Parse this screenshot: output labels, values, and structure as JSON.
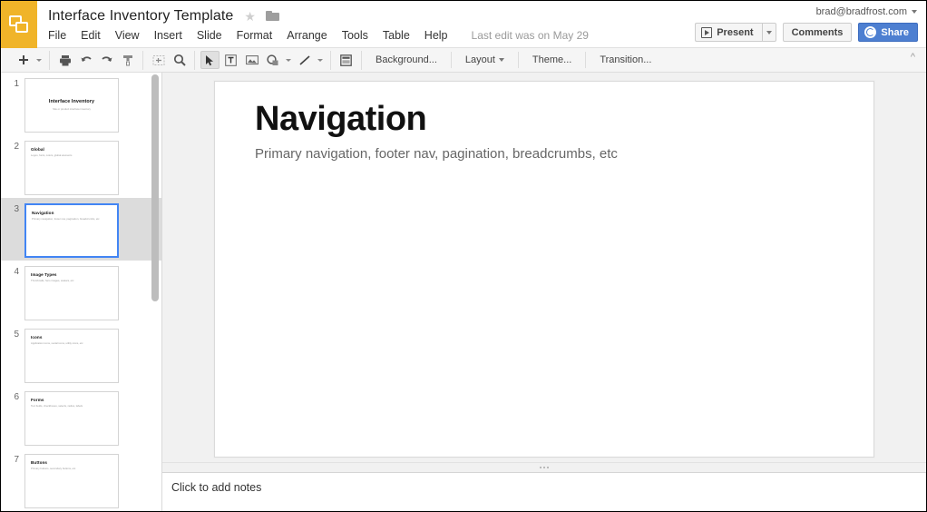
{
  "header": {
    "logo_icon": "slides-logo-icon",
    "doc_title": "Interface Inventory Template",
    "star_icon": "★",
    "folder_icon": "folder-icon",
    "menus": [
      "File",
      "Edit",
      "View",
      "Insert",
      "Slide",
      "Format",
      "Arrange",
      "Tools",
      "Table",
      "Help"
    ],
    "last_edit": "Last edit was on May 29",
    "account_email": "brad@bradfrost.com",
    "present_label": "Present",
    "comments_label": "Comments",
    "share_label": "Share",
    "share_color": "#4d7fd1",
    "logo_color": "#f0b429"
  },
  "toolbar": {
    "new_slide_icon": "plus-icon",
    "print_icon": "print-icon",
    "undo_icon": "undo-icon",
    "redo_icon": "redo-icon",
    "paint_format_icon": "paint-format-icon",
    "fit_icon": "fit-to-screen-icon",
    "zoom_icon": "magnifier-icon",
    "select_icon": "select-arrow-icon",
    "textbox_icon": "text-box-icon",
    "image_icon": "image-icon",
    "shape_icon": "shape-icon",
    "line_icon": "line-icon",
    "layout_icon": "layout-icon",
    "background_label": "Background...",
    "layout_label": "Layout",
    "theme_label": "Theme...",
    "transition_label": "Transition...",
    "collapse_icon": "chevron-up-icon"
  },
  "filmstrip": {
    "slides": [
      {
        "num": "1",
        "title": "Interface Inventory",
        "sub": "Site or product interface inventory",
        "centered": true,
        "selected": false
      },
      {
        "num": "2",
        "title": "Global",
        "sub": "Logos, fonts, colors, global elements",
        "centered": false,
        "selected": false
      },
      {
        "num": "3",
        "title": "Navigation",
        "sub": "Primary navigation, footer nav, pagination, breadcrumbs, etc",
        "centered": false,
        "selected": true
      },
      {
        "num": "4",
        "title": "Image Types",
        "sub": "Thumbnails, hero images, avatars, etc",
        "centered": false,
        "selected": false
      },
      {
        "num": "5",
        "title": "Icons",
        "sub": "Application icons, social icons, utility icons, etc",
        "centered": false,
        "selected": false
      },
      {
        "num": "6",
        "title": "Forms",
        "sub": "Text fields, checkboxes, selects, radios, labels",
        "centered": false,
        "selected": false
      },
      {
        "num": "7",
        "title": "Buttons",
        "sub": "Primary buttons, secondary buttons, etc",
        "centered": false,
        "selected": false
      }
    ]
  },
  "slide": {
    "title": "Navigation",
    "subtitle": "Primary navigation, footer nav, pagination, breadcrumbs, etc"
  },
  "notes": {
    "placeholder": "Click to add notes"
  }
}
